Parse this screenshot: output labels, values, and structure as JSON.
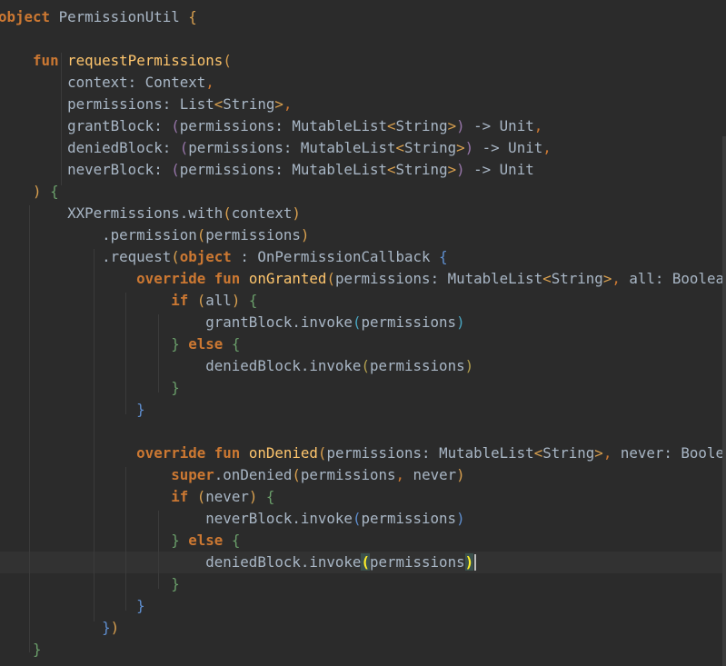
{
  "editor": {
    "lines": [
      {
        "tokens": [
          {
            "t": "object",
            "c": "kw"
          },
          {
            "t": " PermissionUtil ",
            "c": "id"
          },
          {
            "t": "{",
            "c": "par1"
          }
        ]
      },
      {
        "tokens": []
      },
      {
        "tokens": [
          {
            "t": "    ",
            "c": "id"
          },
          {
            "t": "fun",
            "c": "kw"
          },
          {
            "t": " ",
            "c": "id"
          },
          {
            "t": "requestPermissions",
            "c": "fn"
          },
          {
            "t": "(",
            "c": "par1"
          }
        ]
      },
      {
        "tokens": [
          {
            "t": "        context: Context",
            "c": "id"
          },
          {
            "t": ",",
            "c": "punc"
          }
        ]
      },
      {
        "tokens": [
          {
            "t": "        permissions: List",
            "c": "id"
          },
          {
            "t": "<",
            "c": "par1"
          },
          {
            "t": "String",
            "c": "id"
          },
          {
            "t": ">",
            "c": "par1"
          },
          {
            "t": ",",
            "c": "punc"
          }
        ]
      },
      {
        "tokens": [
          {
            "t": "        grantBlock: ",
            "c": "id"
          },
          {
            "t": "(",
            "c": "par2"
          },
          {
            "t": "permissions: MutableList",
            "c": "id"
          },
          {
            "t": "<",
            "c": "par1"
          },
          {
            "t": "String",
            "c": "id"
          },
          {
            "t": ">",
            "c": "par1"
          },
          {
            "t": ")",
            "c": "par2"
          },
          {
            "t": " -> Unit",
            "c": "id"
          },
          {
            "t": ",",
            "c": "punc"
          }
        ]
      },
      {
        "tokens": [
          {
            "t": "        deniedBlock: ",
            "c": "id"
          },
          {
            "t": "(",
            "c": "par2"
          },
          {
            "t": "permissions: MutableList",
            "c": "id"
          },
          {
            "t": "<",
            "c": "par1"
          },
          {
            "t": "String",
            "c": "id"
          },
          {
            "t": ">",
            "c": "par1"
          },
          {
            "t": ")",
            "c": "par2"
          },
          {
            "t": " -> Unit",
            "c": "id"
          },
          {
            "t": ",",
            "c": "punc"
          }
        ]
      },
      {
        "tokens": [
          {
            "t": "        neverBlock: ",
            "c": "id"
          },
          {
            "t": "(",
            "c": "par2"
          },
          {
            "t": "permissions: MutableList",
            "c": "id"
          },
          {
            "t": "<",
            "c": "par1"
          },
          {
            "t": "String",
            "c": "id"
          },
          {
            "t": ">",
            "c": "par1"
          },
          {
            "t": ")",
            "c": "par2"
          },
          {
            "t": " -> Unit",
            "c": "id"
          }
        ]
      },
      {
        "tokens": [
          {
            "t": "    ",
            "c": "id"
          },
          {
            "t": ")",
            "c": "par1"
          },
          {
            "t": " ",
            "c": "id"
          },
          {
            "t": "{",
            "c": "br2"
          }
        ]
      },
      {
        "tokens": [
          {
            "t": "        XXPermissions.with",
            "c": "id"
          },
          {
            "t": "(",
            "c": "par1"
          },
          {
            "t": "context",
            "c": "id"
          },
          {
            "t": ")",
            "c": "par1"
          }
        ]
      },
      {
        "tokens": [
          {
            "t": "            .permission",
            "c": "id"
          },
          {
            "t": "(",
            "c": "par1"
          },
          {
            "t": "permissions",
            "c": "id"
          },
          {
            "t": ")",
            "c": "par1"
          }
        ]
      },
      {
        "tokens": [
          {
            "t": "            .request",
            "c": "id"
          },
          {
            "t": "(",
            "c": "par1"
          },
          {
            "t": "object",
            "c": "kw"
          },
          {
            "t": " : OnPermissionCallback ",
            "c": "id"
          },
          {
            "t": "{",
            "c": "br1"
          }
        ]
      },
      {
        "tokens": [
          {
            "t": "                ",
            "c": "id"
          },
          {
            "t": "override fun",
            "c": "kw"
          },
          {
            "t": " ",
            "c": "id"
          },
          {
            "t": "onGranted",
            "c": "fn"
          },
          {
            "t": "(",
            "c": "par1"
          },
          {
            "t": "permissions: MutableList",
            "c": "id"
          },
          {
            "t": "<",
            "c": "par1"
          },
          {
            "t": "String",
            "c": "id"
          },
          {
            "t": ">",
            "c": "par1"
          },
          {
            "t": ",",
            "c": "punc"
          },
          {
            "t": " all: Boolean",
            "c": "id"
          },
          {
            "t": ")",
            "c": "par1"
          },
          {
            "t": " ",
            "c": "id"
          },
          {
            "t": "{",
            "c": "br1"
          }
        ]
      },
      {
        "tokens": [
          {
            "t": "                    ",
            "c": "id"
          },
          {
            "t": "if",
            "c": "kw"
          },
          {
            "t": " ",
            "c": "id"
          },
          {
            "t": "(",
            "c": "par1"
          },
          {
            "t": "all",
            "c": "id"
          },
          {
            "t": ")",
            "c": "par1"
          },
          {
            "t": " ",
            "c": "id"
          },
          {
            "t": "{",
            "c": "br2"
          }
        ]
      },
      {
        "tokens": [
          {
            "t": "                        grantBlock.invoke",
            "c": "id"
          },
          {
            "t": "(",
            "c": "br3"
          },
          {
            "t": "permissions",
            "c": "id"
          },
          {
            "t": ")",
            "c": "br3"
          }
        ]
      },
      {
        "tokens": [
          {
            "t": "                    ",
            "c": "id"
          },
          {
            "t": "}",
            "c": "br2"
          },
          {
            "t": " ",
            "c": "id"
          },
          {
            "t": "else",
            "c": "kw"
          },
          {
            "t": " ",
            "c": "id"
          },
          {
            "t": "{",
            "c": "br2"
          }
        ]
      },
      {
        "tokens": [
          {
            "t": "                        deniedBlock.invoke",
            "c": "id"
          },
          {
            "t": "(",
            "c": "br4"
          },
          {
            "t": "permissions",
            "c": "id"
          },
          {
            "t": ")",
            "c": "br4"
          }
        ]
      },
      {
        "tokens": [
          {
            "t": "                    ",
            "c": "id"
          },
          {
            "t": "}",
            "c": "br2"
          }
        ]
      },
      {
        "tokens": [
          {
            "t": "                ",
            "c": "id"
          },
          {
            "t": "}",
            "c": "br1"
          }
        ]
      },
      {
        "tokens": []
      },
      {
        "tokens": [
          {
            "t": "                ",
            "c": "id"
          },
          {
            "t": "override fun",
            "c": "kw"
          },
          {
            "t": " ",
            "c": "id"
          },
          {
            "t": "onDenied",
            "c": "fn"
          },
          {
            "t": "(",
            "c": "par1"
          },
          {
            "t": "permissions: MutableList",
            "c": "id"
          },
          {
            "t": "<",
            "c": "par1"
          },
          {
            "t": "String",
            "c": "id"
          },
          {
            "t": ">",
            "c": "par1"
          },
          {
            "t": ",",
            "c": "punc"
          },
          {
            "t": " never: Boolean",
            "c": "id"
          },
          {
            "t": ")",
            "c": "par1"
          },
          {
            "t": " ",
            "c": "id"
          },
          {
            "t": "{",
            "c": "br1"
          }
        ]
      },
      {
        "tokens": [
          {
            "t": "                    ",
            "c": "id"
          },
          {
            "t": "super",
            "c": "kw"
          },
          {
            "t": ".onDenied",
            "c": "id"
          },
          {
            "t": "(",
            "c": "par1"
          },
          {
            "t": "permissions",
            "c": "id"
          },
          {
            "t": ",",
            "c": "punc"
          },
          {
            "t": " never",
            "c": "id"
          },
          {
            "t": ")",
            "c": "par1"
          }
        ]
      },
      {
        "tokens": [
          {
            "t": "                    ",
            "c": "id"
          },
          {
            "t": "if",
            "c": "kw"
          },
          {
            "t": " ",
            "c": "id"
          },
          {
            "t": "(",
            "c": "par1"
          },
          {
            "t": "never",
            "c": "id"
          },
          {
            "t": ")",
            "c": "par1"
          },
          {
            "t": " ",
            "c": "id"
          },
          {
            "t": "{",
            "c": "br2"
          }
        ]
      },
      {
        "tokens": [
          {
            "t": "                        neverBlock.invoke",
            "c": "id"
          },
          {
            "t": "(",
            "c": "br1"
          },
          {
            "t": "permissions",
            "c": "id"
          },
          {
            "t": ")",
            "c": "br1"
          }
        ]
      },
      {
        "tokens": [
          {
            "t": "                    ",
            "c": "id"
          },
          {
            "t": "}",
            "c": "br2"
          },
          {
            "t": " ",
            "c": "id"
          },
          {
            "t": "else",
            "c": "kw"
          },
          {
            "t": " ",
            "c": "id"
          },
          {
            "t": "{",
            "c": "br2"
          }
        ]
      },
      {
        "tokens": [
          {
            "t": "                        deniedBlock.invoke",
            "c": "id"
          },
          {
            "t": "(",
            "c": "match"
          },
          {
            "t": "permissions",
            "c": "id"
          },
          {
            "t": ")",
            "c": "match"
          }
        ],
        "caret": true
      },
      {
        "tokens": [
          {
            "t": "                    ",
            "c": "id"
          },
          {
            "t": "}",
            "c": "br2"
          }
        ]
      },
      {
        "tokens": [
          {
            "t": "                ",
            "c": "id"
          },
          {
            "t": "}",
            "c": "br1"
          }
        ]
      },
      {
        "tokens": [
          {
            "t": "            ",
            "c": "id"
          },
          {
            "t": "}",
            "c": "br1"
          },
          {
            "t": ")",
            "c": "par1"
          }
        ]
      },
      {
        "tokens": [
          {
            "t": "    ",
            "c": "id"
          },
          {
            "t": "}",
            "c": "br2"
          }
        ]
      }
    ]
  },
  "colors": {
    "background": "#2b2b2b",
    "current_line": "#323232",
    "keyword": "#cc7832",
    "function": "#ffc66d",
    "identifier": "#a9b7c6",
    "bracket_match": "#ffef28"
  }
}
